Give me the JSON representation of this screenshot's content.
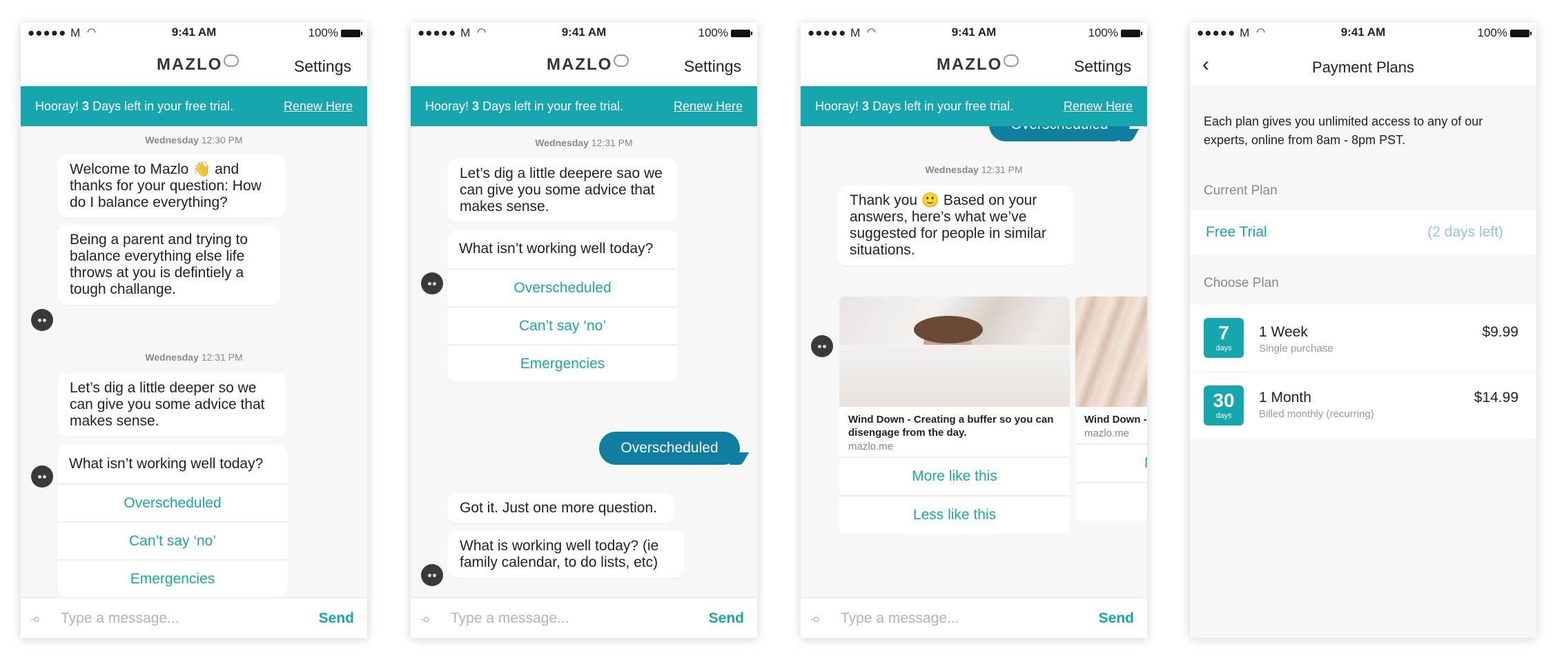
{
  "status": {
    "carrier": "●●●●● M",
    "time": "9:41 AM",
    "battery": "100%"
  },
  "nav": {
    "logo": "MAZLO",
    "settings": "Settings"
  },
  "trial": {
    "prefix": "Hooray!",
    "days": "3",
    "suffix": "Days left in your free trial.",
    "renew": "Renew Here"
  },
  "input": {
    "placeholder": "Type a message...",
    "send": "Send"
  },
  "screen1": {
    "ts1_day": "Wednesday",
    "ts1_time": "12:30 PM",
    "msg1": "Welcome to Mazlo 👋 and thanks for your question: How do I balance everything?",
    "msg2": "Being a parent and trying to balance everything else life throws at you is defintiely a tough challange.",
    "ts2_day": "Wednesday",
    "ts2_time": "12:31 PM",
    "msg3": "Let’s dig a little deeper so we can give you some advice that makes sense.",
    "question": "What isn’t working well today?",
    "options": [
      "Overscheduled",
      "Can’t say ‘no’",
      "Emergencies"
    ]
  },
  "screen2": {
    "ts_day": "Wednesday",
    "ts_time": "12:31 PM",
    "msg1": "Let’s dig a little deepere sao we can give you some advice that makes sense.",
    "question": "What isn’t working well today?",
    "options": [
      "Overscheduled",
      "Can’t say ‘no’",
      "Emergencies"
    ],
    "reply": "Overscheduled",
    "msg2": "Got it. Just one more question.",
    "msg3": "What is working well today? (ie family calendar, to do lists, etc)"
  },
  "screen3": {
    "reply": "Overscheduled",
    "ts_day": "Wednesday",
    "ts_time": "12:31 PM",
    "msg1": "Thank you 🙂 Based on your answers, here’s what we’ve suggested for people in similar situations.",
    "rec1_title": "Wind Down - Creating a buffer so you can disengage from the day.",
    "rec1_src": "mazlo.me",
    "rec2_title": "Wind Down - C can disenga",
    "rec2_src": "mazlo.me",
    "more": "More like this",
    "less": "Less like this",
    "more_partial": "M"
  },
  "screen4": {
    "title": "Payment Plans",
    "desc": "Each plan gives you unlimited access to any of our experts, online from 8am - 8pm PST.",
    "current_label": "Current Plan",
    "current_plan": "Free Trial",
    "current_days": "(2 days left)",
    "choose_label": "Choose Plan",
    "plans": [
      {
        "num": "7",
        "unit": "days",
        "name": "1 Week",
        "sub": "Single purchase",
        "price": "$9.99"
      },
      {
        "num": "30",
        "unit": "days",
        "name": "1 Month",
        "sub": "Billed monthly (recurring)",
        "price": "$14.99"
      }
    ]
  }
}
